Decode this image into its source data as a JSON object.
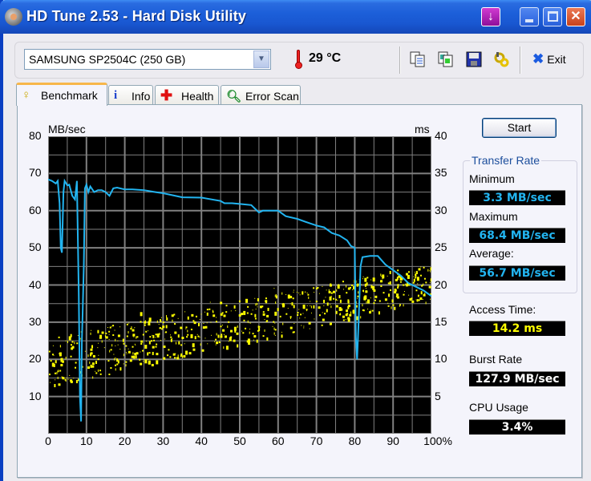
{
  "window": {
    "title": "HD Tune 2.53 - Hard Disk Utility"
  },
  "toolbar": {
    "drive": "SAMSUNG SP2504C (250 GB)",
    "temperature": "29 °C",
    "exit_label": "Exit",
    "icons": [
      "copy-text-icon",
      "copy-screenshot-icon",
      "save-icon",
      "options-icon"
    ]
  },
  "tabs": [
    {
      "label": "Benchmark",
      "icon": "lightbulb-icon",
      "active": true
    },
    {
      "label": "Info",
      "icon": "info-icon",
      "active": false
    },
    {
      "label": "Health",
      "icon": "health-cross-icon",
      "active": false
    },
    {
      "label": "Error Scan",
      "icon": "magnifier-icon",
      "active": false
    }
  ],
  "benchmark": {
    "start_label": "Start",
    "transfer_rate_title": "Transfer Rate",
    "minimum_label": "Minimum",
    "minimum_value": "3.3 MB/sec",
    "maximum_label": "Maximum",
    "maximum_value": "68.4 MB/sec",
    "average_label": "Average:",
    "average_value": "56.7 MB/sec",
    "access_time_label": "Access Time:",
    "access_time_value": "14.2 ms",
    "burst_rate_label": "Burst Rate",
    "burst_rate_value": "127.9 MB/sec",
    "cpu_usage_label": "CPU Usage",
    "cpu_usage_value": "3.4%",
    "colors": {
      "transfer_line": "#22B4F0",
      "access_dots": "#FFFF00",
      "rate_text": "#22B4F0",
      "access_text": "#FFFF00",
      "burst_text": "#FFFFFF",
      "plot_bg": "#000000",
      "grid": "#808080"
    }
  },
  "chart_data": {
    "type": "line",
    "title": "",
    "xlabel": "%",
    "ylabel": "MB/sec",
    "y2label": "ms",
    "xlim": [
      0,
      100
    ],
    "ylim": [
      0,
      80
    ],
    "y2lim": [
      0,
      40
    ],
    "x_ticks": [
      "0",
      "10",
      "20",
      "30",
      "40",
      "50",
      "60",
      "70",
      "80",
      "90",
      "100%"
    ],
    "y_ticks": [
      "10",
      "20",
      "30",
      "40",
      "50",
      "60",
      "70",
      "80"
    ],
    "y2_ticks": [
      "5",
      "10",
      "15",
      "20",
      "25",
      "30",
      "35",
      "40"
    ],
    "grid": true,
    "series": [
      {
        "name": "Transfer Rate (MB/sec)",
        "axis": "left",
        "x": [
          0,
          1,
          2,
          2.5,
          3,
          3.3,
          3.6,
          4,
          4.3,
          5,
          5.5,
          6.3,
          7,
          7.5,
          8,
          8.3,
          8.6,
          8.8,
          9,
          9.3,
          9.6,
          10,
          10.5,
          11,
          12,
          13,
          14,
          15,
          16,
          17,
          18,
          20,
          22,
          25,
          28,
          30,
          35,
          40,
          45,
          46,
          48,
          50,
          53,
          55,
          56,
          57,
          58,
          60,
          62,
          65,
          68,
          70,
          72,
          74,
          76,
          78,
          79,
          80,
          80.3,
          80.6,
          81,
          81.5,
          82,
          84,
          86,
          88,
          90,
          92,
          94,
          96,
          98,
          100
        ],
        "values": [
          68.4,
          68,
          67.3,
          68,
          62,
          50,
          48.7,
          65,
          68,
          66.8,
          67,
          64,
          63,
          68,
          38,
          10,
          3.3,
          25,
          32,
          45,
          66,
          67,
          65,
          66.5,
          65,
          65.5,
          65.5,
          65,
          64,
          66,
          66.2,
          65.7,
          65.7,
          65.5,
          65,
          64.7,
          63.6,
          63.5,
          62.6,
          62,
          62,
          61.8,
          61.5,
          59.5,
          60,
          60,
          60,
          60,
          58.5,
          57.8,
          56.7,
          56,
          55.5,
          54,
          53.3,
          52,
          50.5,
          50,
          26,
          20,
          30,
          45,
          47.5,
          47.8,
          47.8,
          45.5,
          44,
          42.5,
          40.5,
          39.5,
          38.5,
          37
        ]
      },
      {
        "name": "Access Time (ms)",
        "axis": "right",
        "type": "scatter",
        "description": "Yellow scattered points forming a band rising from ~8-13 ms at 0% to ~17-21 ms at 100%",
        "band_min_start_ms": 5,
        "band_max_start_ms": 13,
        "band_min_end_ms": 17,
        "band_max_end_ms": 23
      }
    ]
  }
}
